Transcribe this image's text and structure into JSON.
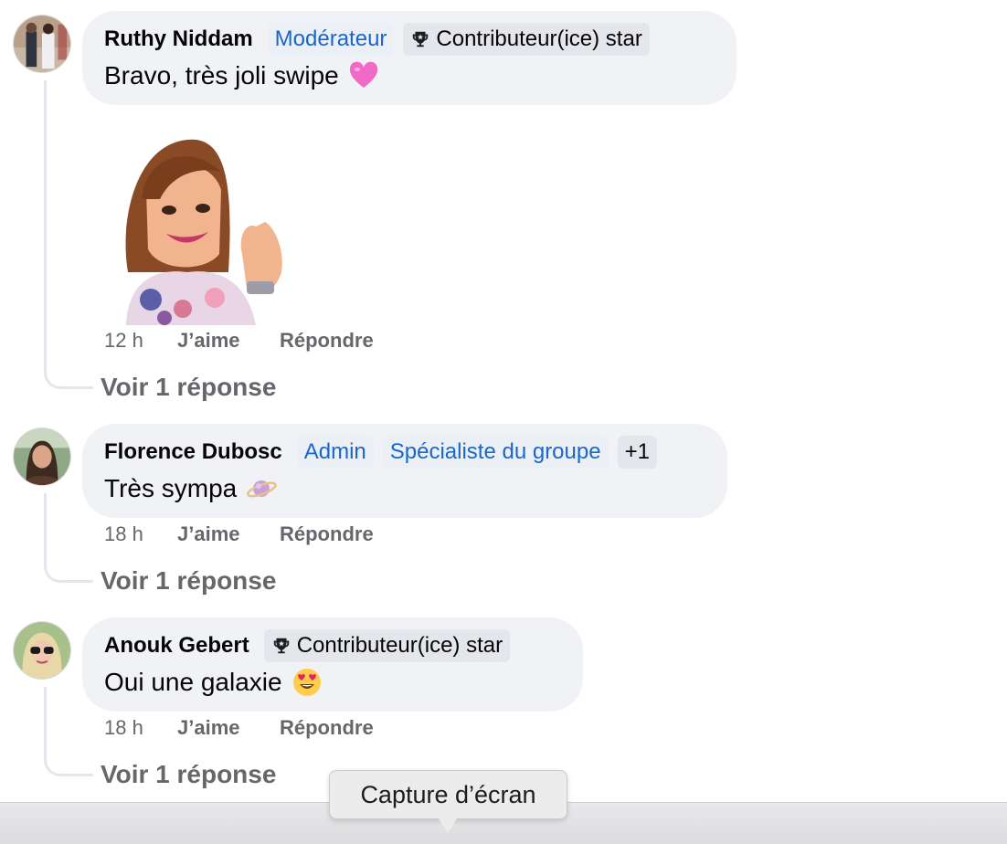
{
  "comments": [
    {
      "author": "Ruthy Niddam",
      "badges": [
        {
          "label": "Modérateur",
          "style": "blue"
        },
        {
          "label": "Contributeur(ice) star",
          "style": "gray",
          "icon": "trophy-icon"
        }
      ],
      "text": "Bravo, très joli swipe",
      "emoji": "pink-heart-emoji",
      "has_sticker": true,
      "time": "12 h",
      "like_label": "J’aime",
      "reply_label": "Répondre",
      "view_replies": "Voir 1 réponse"
    },
    {
      "author": "Florence Dubosc",
      "badges": [
        {
          "label": "Admin",
          "style": "blue"
        },
        {
          "label": "Spécialiste du groupe",
          "style": "blue"
        },
        {
          "label": "+1",
          "style": "gray"
        }
      ],
      "text": "Très sympa",
      "emoji": "ringed-planet-emoji",
      "time": "18 h",
      "like_label": "J’aime",
      "reply_label": "Répondre",
      "view_replies": "Voir 1 réponse"
    },
    {
      "author": "Anouk Gebert",
      "badges": [
        {
          "label": "Contributeur(ice) star",
          "style": "gray",
          "icon": "trophy-icon"
        }
      ],
      "text": "Oui une galaxie",
      "emoji": "heart-eyes-emoji",
      "time": "18 h",
      "like_label": "J’aime",
      "reply_label": "Répondre",
      "view_replies": "Voir 1 réponse"
    }
  ],
  "tooltip": {
    "label": "Capture d’écran"
  },
  "colors": {
    "bubble": "#f0f2f5",
    "badge_blue": "#1a66c9",
    "meta_gray": "#65676b"
  }
}
